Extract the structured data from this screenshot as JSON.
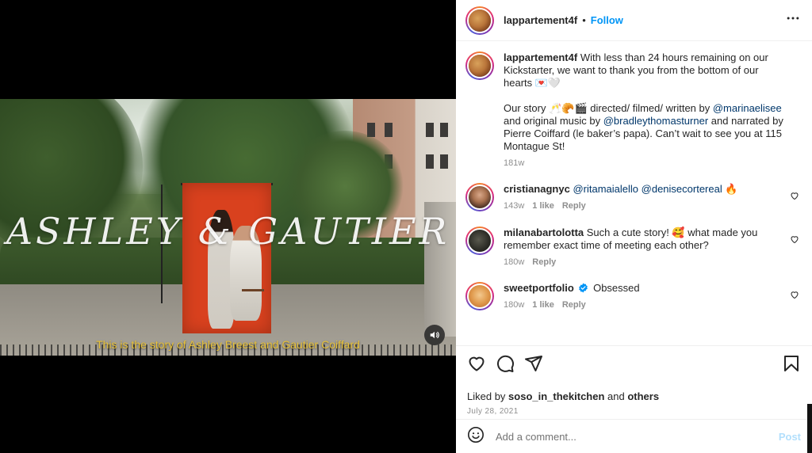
{
  "media": {
    "overlay_title": "ASHLEY & GAUTIER",
    "subtitle": "This is the story of Ashley Breest and Gautier Coiffard",
    "mute_icon": "speaker-icon"
  },
  "header": {
    "username": "lappartement4f",
    "separator": "•",
    "follow_label": "Follow",
    "more_icon": "more-dots-icon"
  },
  "caption": {
    "username": "lappartement4f",
    "text_1": "With less than 24 hours remaining on our Kickstarter, we want to thank you from the bottom of our hearts 💌🤍",
    "text_2a": "Our story 🥂🥐🎬 directed/ filmed/ written by ",
    "mention_1": "@marinaelisee",
    "text_2b": " and original music by ",
    "mention_2": "@bradleythomasturner",
    "text_2c": " and narrated by Pierre Coiffard (le baker’s papa). Can’t wait to see you at 115 Montague St!",
    "time": "181w"
  },
  "comments": [
    {
      "username": "cristianagnyc",
      "mention_1": "@ritamaialello",
      "mention_2": "@denisecortereal",
      "emoji": "🔥",
      "time": "143w",
      "likes": "1 like",
      "reply": "Reply"
    },
    {
      "username": "milanabartolotta",
      "text": "Such a cute story! 🥰 what made you remember exact time of meeting each other?",
      "time": "180w",
      "reply": "Reply"
    },
    {
      "username": "sweetportfolio",
      "text": "Obsessed",
      "verified": true,
      "time": "180w",
      "likes": "1 like",
      "reply": "Reply"
    }
  ],
  "actions": {
    "liked_by_prefix": "Liked by ",
    "liked_by_user": "soso_in_thekitchen",
    "liked_by_and": " and ",
    "liked_by_others": "others",
    "date": "July 28, 2021"
  },
  "add_comment": {
    "placeholder": "Add a comment...",
    "post_label": "Post"
  },
  "colors": {
    "link_blue": "#0095f6",
    "mention_blue": "#00376b",
    "muted_gray": "#8e8e8e",
    "subtitle_yellow": "#e8c23a",
    "backdrop_red": "#d9411e"
  }
}
